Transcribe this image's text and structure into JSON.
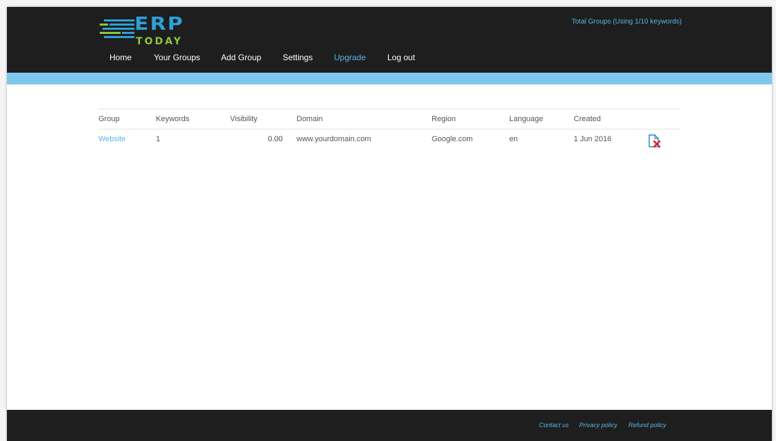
{
  "logo": {
    "word": "ERP",
    "sub": "TODAY",
    "brand_blue": "#2f9fd8",
    "brand_green": "#8cc63f"
  },
  "header": {
    "total_groups": "Total Groups (Using 1/10 keywords)"
  },
  "nav": [
    {
      "label": "Home",
      "active": false
    },
    {
      "label": "Your Groups",
      "active": false
    },
    {
      "label": "Add Group",
      "active": false
    },
    {
      "label": "Settings",
      "active": false
    },
    {
      "label": "Upgrade",
      "active": true
    },
    {
      "label": "Log out",
      "active": false
    }
  ],
  "table": {
    "columns": [
      "Group",
      "Keywords",
      "Visibility",
      "Domain",
      "Region",
      "Language",
      "Created"
    ],
    "rows": [
      {
        "group": "Website",
        "keywords": "1",
        "visibility": "0.00",
        "domain": "www.yourdomain.com",
        "region": "Google.com",
        "language": "en",
        "created": "1 Jun 2016",
        "action_icon": "delete-document-icon"
      }
    ]
  },
  "footer": {
    "links": [
      "Contact us",
      "Privacy policy",
      "Refund policy"
    ]
  },
  "colors": {
    "header_bg": "#1e1e1e",
    "stripe": "#7ec8ee",
    "accent": "#5ab4e5",
    "delete_red": "#e02020"
  }
}
